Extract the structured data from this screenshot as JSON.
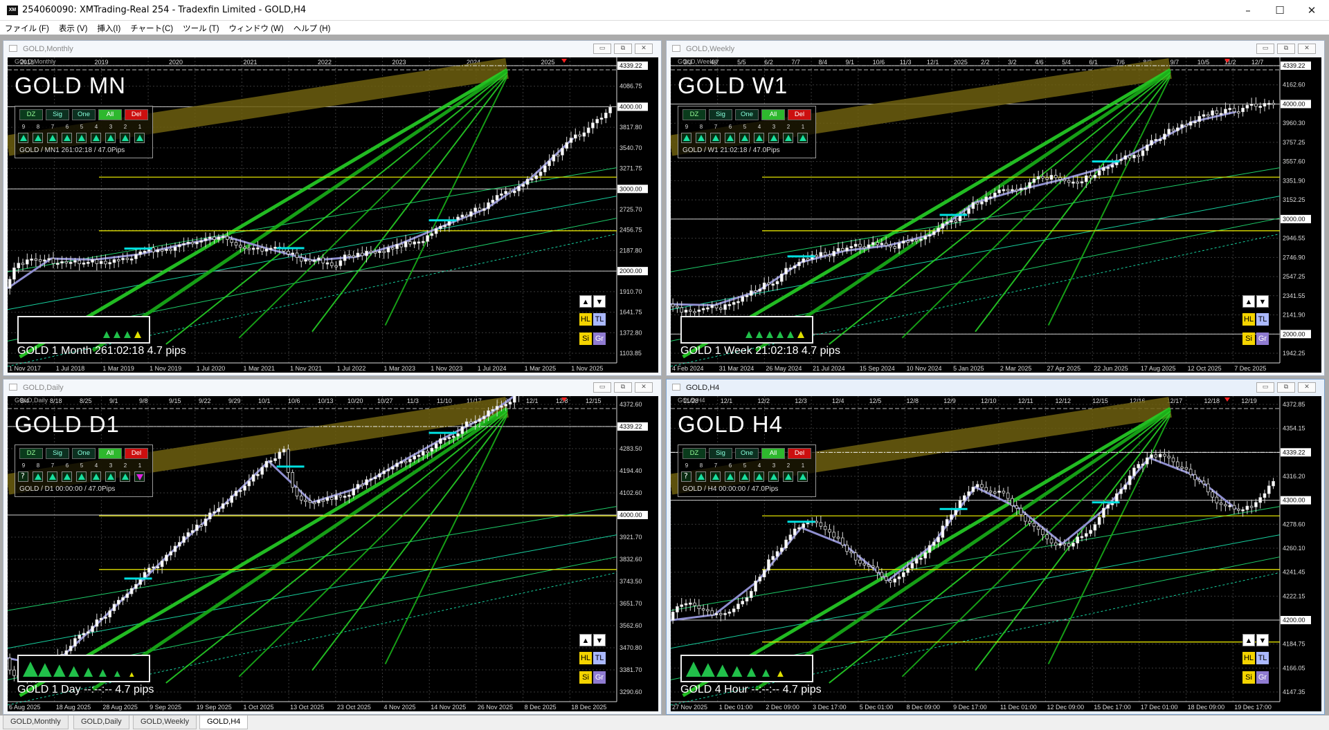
{
  "window": {
    "title": "254060090: XMTrading-Real 254 - Tradexfin Limited - GOLD,H4",
    "app_icon": "XM",
    "minimize": "–",
    "maximize": "☐",
    "close": "✕"
  },
  "menu": [
    "ファイル (F)",
    "表示 (V)",
    "挿入(I)",
    "チャート(C)",
    "ツール (T)",
    "ウィンドウ (W)",
    "ヘルプ (H)"
  ],
  "charts": [
    {
      "id": "monthly",
      "title": "GOLD,Monthly",
      "symbol_small": "GOLD,Monthly",
      "label": "GOLD MN",
      "panel_info": "GOLD / MN1 261:02:18 / 47.0Pips",
      "bottom_info": "GOLD  1 Month  261:02:18  4.7 pips",
      "strength_count": 4,
      "top_dates": [
        "2018",
        "2019",
        "2020",
        "2021",
        "2022",
        "2023",
        "2024",
        "2025"
      ],
      "bottom_dates": [
        "1 Nov 2017",
        "1 Jul 2018",
        "1 Mar 2019",
        "1 Nov 2019",
        "1 Jul 2020",
        "1 Mar 2021",
        "1 Nov 2021",
        "1 Jul 2022",
        "1 Mar 2023",
        "1 Nov 2023",
        "1 Jul 2024",
        "1 Mar 2025",
        "1 Nov 2025"
      ],
      "prices": [
        "4339.22",
        "4086.75",
        "4000.00",
        "3817.80",
        "3540.70",
        "3271.75",
        "3000.00",
        "2725.70",
        "2456.75",
        "2187.80",
        "2000.00",
        "1910.70",
        "1641.75",
        "1372.80",
        "1103.85"
      ],
      "highlighted_prices": [
        "4339.22",
        "4000.00",
        "3000.00",
        "2000.00"
      ]
    },
    {
      "id": "weekly",
      "title": "GOLD,Weekly",
      "symbol_small": "GOLD,Weekly",
      "label": "GOLD W1",
      "panel_info": "GOLD / W1 21:02:18 / 47.0Pips",
      "bottom_info": "GOLD  1 Week  21:02:18  4.7 pips",
      "strength_count": 6,
      "top_dates": [
        "3/3",
        "4/7",
        "5/5",
        "6/2",
        "7/7",
        "8/4",
        "9/1",
        "10/6",
        "11/3",
        "12/1",
        "2025",
        "2/2",
        "3/2",
        "4/6",
        "5/4",
        "6/1",
        "7/6",
        "8/3",
        "9/7",
        "10/5",
        "11/2",
        "12/7"
      ],
      "bottom_dates": [
        "4 Feb 2024",
        "31 Mar 2024",
        "26 May 2024",
        "21 Jul 2024",
        "15 Sep 2024",
        "10 Nov 2024",
        "5 Jan 2025",
        "2 Mar 2025",
        "27 Apr 2025",
        "22 Jun 2025",
        "17 Aug 2025",
        "12 Oct 2025",
        "7 Dec 2025"
      ],
      "prices": [
        "4339.22",
        "4162.60",
        "4000.00",
        "3960.30",
        "3757.25",
        "3557.60",
        "3351.90",
        "3152.25",
        "3000.00",
        "2946.55",
        "2746.90",
        "2547.25",
        "2341.55",
        "2141.90",
        "2000.00",
        "1942.25"
      ],
      "highlighted_prices": [
        "4339.22",
        "4000.00",
        "3000.00",
        "2000.00"
      ]
    },
    {
      "id": "daily",
      "title": "GOLD,Daily",
      "symbol_small": "GOLD,Daily",
      "label": "GOLD D1",
      "panel_info": "GOLD / D1 00:00:00 / 47.0Pips",
      "bottom_info": "GOLD  1 Day  --:--:--  4.7 pips",
      "strength_count": 8,
      "top_dates": [
        "8/4",
        "8/18",
        "8/25",
        "9/1",
        "9/8",
        "9/15",
        "9/22",
        "9/29",
        "10/1",
        "10/6",
        "10/13",
        "10/20",
        "10/27",
        "11/3",
        "11/10",
        "11/17",
        "11/24",
        "12/1",
        "12/8",
        "12/15"
      ],
      "bottom_dates": [
        "6 Aug 2025",
        "18 Aug 2025",
        "28 Aug 2025",
        "9 Sep 2025",
        "19 Sep 2025",
        "1 Oct 2025",
        "13 Oct 2025",
        "23 Oct 2025",
        "4 Nov 2025",
        "14 Nov 2025",
        "26 Nov 2025",
        "8 Dec 2025",
        "18 Dec 2025"
      ],
      "prices": [
        "4372.60",
        "4339.22",
        "4283.50",
        "4194.40",
        "4102.60",
        "4000.00",
        "3921.70",
        "3832.60",
        "3743.50",
        "3651.70",
        "3562.60",
        "3470.80",
        "3381.70",
        "3290.60"
      ],
      "highlighted_prices": [
        "4339.22",
        "4000.00"
      ]
    },
    {
      "id": "h4",
      "title": "GOLD,H4",
      "symbol_small": "GOLD,H4",
      "label": "GOLD H4",
      "panel_info": "GOLD / H4 00:00:00 / 47.0Pips",
      "bottom_info": "GOLD  4 Hour  --:--:--  4.7 pips",
      "strength_count": 7,
      "top_dates": [
        "11/28",
        "12/1",
        "12/2",
        "12/3",
        "12/4",
        "12/5",
        "12/8",
        "12/9",
        "12/10",
        "12/11",
        "12/12",
        "12/15",
        "12/16",
        "12/17",
        "12/18",
        "12/19"
      ],
      "bottom_dates": [
        "27 Nov 2025",
        "1 Dec 01:00",
        "2 Dec 09:00",
        "3 Dec 17:00",
        "5 Dec 01:00",
        "8 Dec 09:00",
        "9 Dec 17:00",
        "11 Dec 01:00",
        "12 Dec 09:00",
        "15 Dec 17:00",
        "17 Dec 01:00",
        "18 Dec 09:00",
        "19 Dec 17:00"
      ],
      "prices": [
        "4372.85",
        "4354.15",
        "4339.22",
        "4316.20",
        "4300.00",
        "4278.60",
        "4260.10",
        "4241.45",
        "4222.15",
        "4200.00",
        "4184.75",
        "4166.05",
        "4147.35"
      ],
      "highlighted_prices": [
        "4339.22",
        "4300.00",
        "4200.00"
      ]
    }
  ],
  "panel_buttons": [
    "DZ",
    "Sig",
    "One",
    "All",
    "Del"
  ],
  "panel_numbers": [
    "9",
    "8",
    "7",
    "6",
    "5",
    "4",
    "3",
    "2",
    "1"
  ],
  "mini_buttons": {
    "up": "▲",
    "down": "▼",
    "hl": "HL",
    "tl": "TL",
    "si": "Si",
    "gr": "Gr"
  },
  "tabs": [
    "GOLD,Monthly",
    "GOLD,Daily",
    "GOLD,Weekly",
    "GOLD,H4"
  ],
  "active_tab": "GOLD,H4",
  "colors": {
    "chart_bg": "#000000",
    "green_line": "#22cc22",
    "yellow_line": "#e0e000",
    "gold_band": "#8a7a10",
    "cyan_marker": "#00e0e0",
    "bull_candle": "#ffffff",
    "bear_candle": "#000000",
    "zigzag": "#8f8fd0"
  }
}
